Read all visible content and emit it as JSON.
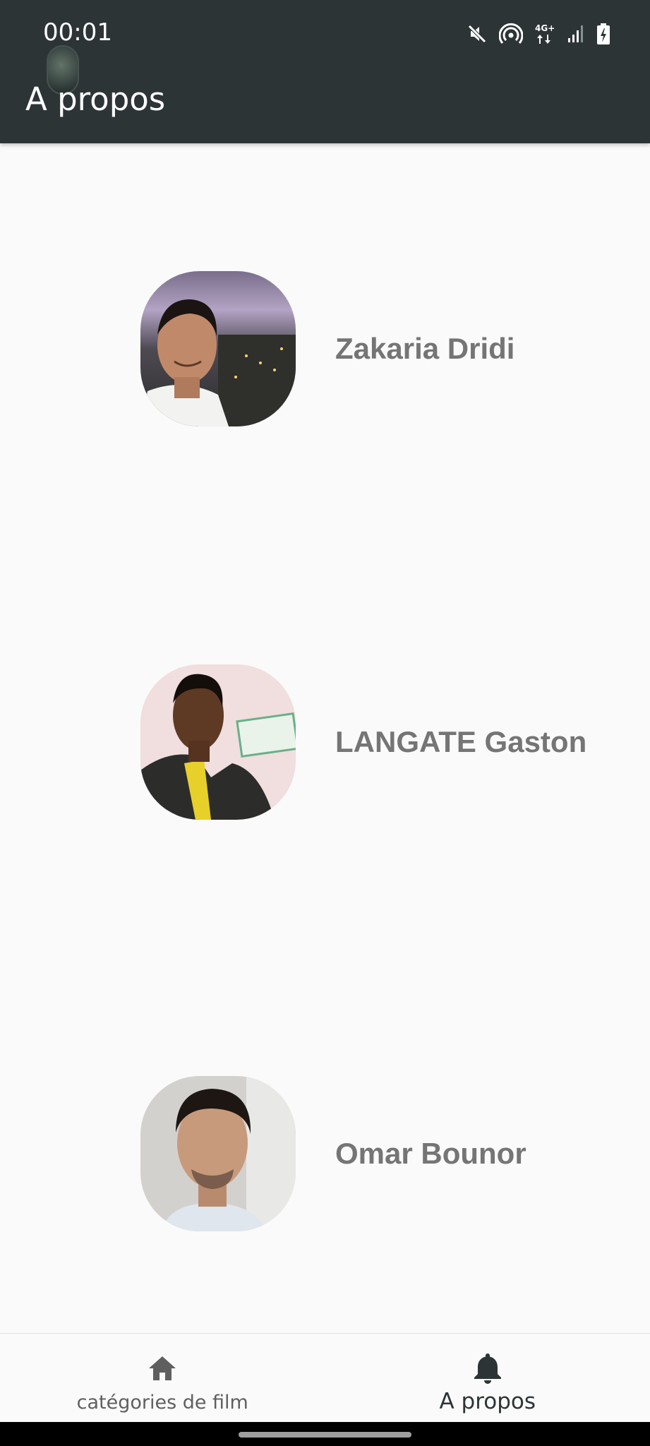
{
  "status_bar": {
    "time": "00:01",
    "network_label": "4G+"
  },
  "app_bar": {
    "title": "A propos"
  },
  "members": [
    {
      "name": "Zakaria Dridi"
    },
    {
      "name": "LANGATE Gaston"
    },
    {
      "name": "Omar Bounor"
    }
  ],
  "bottom_nav": {
    "items": [
      {
        "label": "catégories de film",
        "icon": "home-icon",
        "active": false
      },
      {
        "label": "A propos",
        "icon": "bell-icon",
        "active": true
      }
    ]
  },
  "colors": {
    "app_bar": "#2d3436",
    "background": "#fafafa",
    "member_name": "#757575",
    "nav_active": "#2d3436",
    "nav_inactive": "#5f5f5f"
  }
}
